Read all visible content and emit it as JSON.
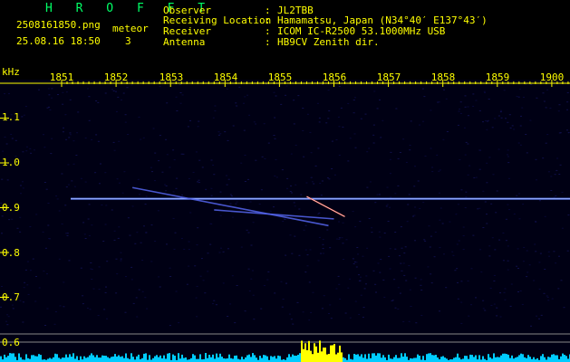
{
  "header": {
    "app_title": "H R O F F T",
    "filename": "2508161850.png",
    "timestamp": "25.08.16 18:50",
    "count_label": "meteor",
    "count_value": "3",
    "fields": [
      {
        "label": "Observer",
        "value": "JL2TBB"
      },
      {
        "label": "Receiving Location",
        "value": "Hamamatsu, Japan (N34°40′ E137°43′)"
      },
      {
        "label": "Receiver",
        "value": "ICOM IC-R2500 53.1000MHz USB"
      },
      {
        "label": "Antenna",
        "value": "HB9CV Zenith dir."
      }
    ],
    "separator": ":"
  },
  "chart_data": {
    "type": "heatmap",
    "ylabel": "kHz",
    "x_ticks": [
      "1851",
      "1852",
      "1853",
      "1854",
      "1855",
      "1856",
      "1857",
      "1858",
      "1859",
      "1900"
    ],
    "y_ticks": [
      "1.1",
      "1.0",
      "0.9",
      "0.8",
      "0.7",
      "0.6"
    ],
    "ylim": [
      0.58,
      1.1
    ],
    "carrier_khz": 0.92,
    "meteor_traces": [
      {
        "x_start": "1852.3",
        "x_end": "1855.9",
        "y_start": 0.945,
        "y_end": 0.86
      },
      {
        "x_start": "1853.8",
        "x_end": "1856.0",
        "y_start": 0.895,
        "y_end": 0.875
      }
    ],
    "bottom_meter_colors": {
      "normal": "#00ccff",
      "peak": "#ffff00"
    },
    "colors": {
      "carrier": "#6688ff",
      "grid": "#888888",
      "ticks": "#ffff00"
    }
  }
}
